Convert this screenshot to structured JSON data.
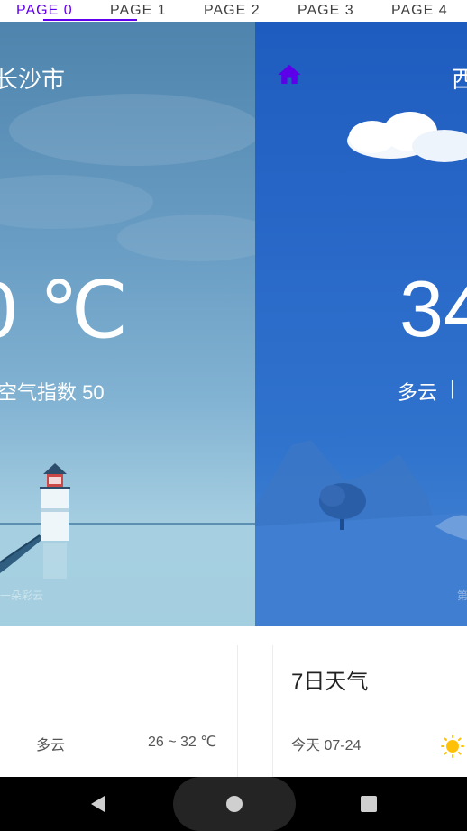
{
  "tabs": [
    {
      "label": "PAGE 0",
      "active": true
    },
    {
      "label": "PAGE 1",
      "active": false
    },
    {
      "label": "PAGE 2",
      "active": false
    },
    {
      "label": "PAGE 3",
      "active": false
    },
    {
      "label": "PAGE 4",
      "active": false
    }
  ],
  "accent_color": "#6200ee",
  "left_page": {
    "city": "长沙市",
    "temperature": "0 ℃",
    "air_quality": "空气指数 50",
    "watermark": "一朵彩云",
    "scene": "lighthouse-scene"
  },
  "right_page": {
    "home_icon": "home-icon",
    "city": "西",
    "temperature": "34",
    "condition": "多云",
    "separator": "|",
    "watermark": "第",
    "scene": "mountain-tree-scene"
  },
  "left_card": {
    "condition": "多云",
    "temp_range": "26 ~ 32 ℃"
  },
  "right_card": {
    "title": "7日天气",
    "day_label": "今天 07-24",
    "weather_icon": "sun-icon"
  },
  "system_nav": {
    "back_icon": "back-icon",
    "home_icon": "home-icon",
    "recents_icon": "recents-icon"
  }
}
